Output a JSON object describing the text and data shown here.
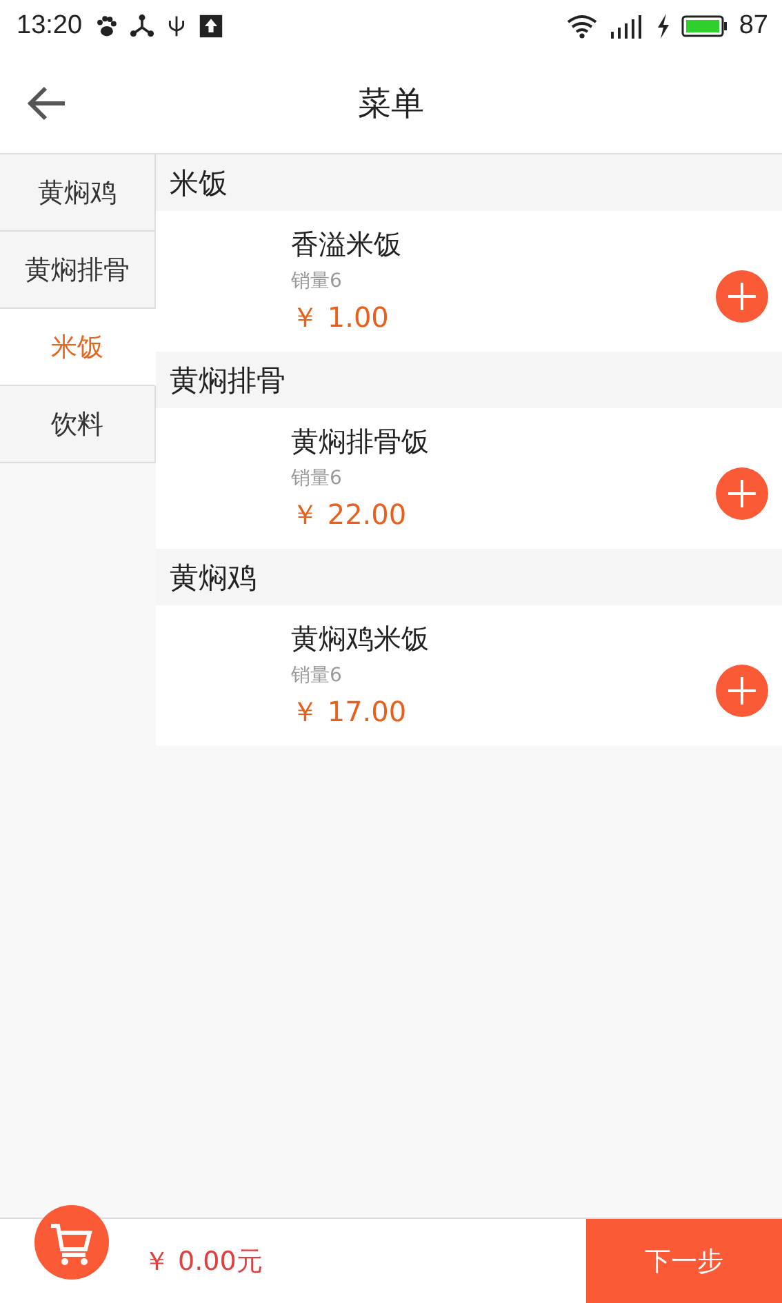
{
  "status_bar": {
    "time": "13:20",
    "battery": "87"
  },
  "header": {
    "title": "菜单"
  },
  "sidebar": {
    "items": [
      {
        "label": "黄焖鸡",
        "selected": false
      },
      {
        "label": "黄焖排骨",
        "selected": false
      },
      {
        "label": "米饭",
        "selected": true
      },
      {
        "label": "饮料",
        "selected": false
      }
    ]
  },
  "sections": [
    {
      "title": "米饭",
      "items": [
        {
          "name": "香溢米饭",
          "sales": "销量6",
          "price": "￥ 1.00"
        }
      ]
    },
    {
      "title": "黄焖排骨",
      "items": [
        {
          "name": "黄焖排骨饭",
          "sales": "销量6",
          "price": "￥ 22.00"
        }
      ]
    },
    {
      "title": "黄焖鸡",
      "items": [
        {
          "name": "黄焖鸡米饭",
          "sales": "销量6",
          "price": "￥ 17.00"
        }
      ]
    }
  ],
  "footer": {
    "total": "￥ 0.00元",
    "next_button": "下一步"
  }
}
